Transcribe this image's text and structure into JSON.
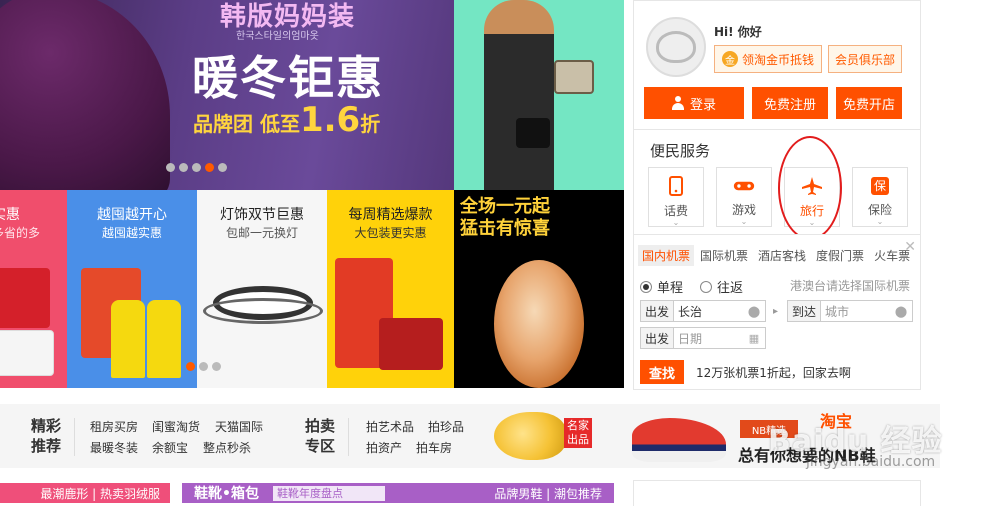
{
  "hero": {
    "title": "韩版妈妈装",
    "korean": "한국스타일의엄마옷",
    "headline": "暖冬钜惠",
    "promo_prefix": "品牌团 低至",
    "promo_number": "1.6",
    "promo_suffix": "折"
  },
  "login": {
    "greeting": "Hi! 你好",
    "coin_icon": "金",
    "coin_label": "领淘金币抵钱",
    "club_label": "会员俱乐部",
    "login_label": "登录",
    "register_label": "免费注册",
    "open_shop_label": "免费开店"
  },
  "service": {
    "title": "便民服务",
    "items": [
      {
        "label": "话费",
        "icon": "phone-icon"
      },
      {
        "label": "游戏",
        "icon": "gamepad-icon"
      },
      {
        "label": "旅行",
        "icon": "airplane-icon",
        "active": true
      },
      {
        "label": "保险",
        "icon": "insurance-icon",
        "glyph": "保"
      }
    ]
  },
  "flight": {
    "tabs": [
      "国内机票",
      "国际机票",
      "酒店客栈",
      "度假门票",
      "火车票"
    ],
    "one_way": "单程",
    "round_trip": "往返",
    "intl_hint": "港澳台请选择国际机票",
    "from_tag": "出发",
    "from_value": "长治",
    "to_tag": "到达",
    "to_placeholder": "城市",
    "date_tag": "出发",
    "date_placeholder": "日期",
    "search_label": "查找",
    "promo": "12万张机票1折起，回家去啊"
  },
  "tiles": [
    {
      "title": "实惠",
      "sub": "多省的多"
    },
    {
      "title": "越囤越开心",
      "sub": "越囤越实惠"
    },
    {
      "title": "灯饰双节巨惠",
      "sub": "包邮一元换灯"
    },
    {
      "title": "每周精选爆款",
      "sub": "大包装更实惠"
    },
    {
      "title": "全场一元起",
      "sub": "猛击有惊喜"
    }
  ],
  "category": {
    "head1": "精彩推荐",
    "links1": [
      "租房买房",
      "闺蜜淘货",
      "天猫国际",
      "最暖冬装",
      "余额宝",
      "整点秒杀"
    ],
    "head2": "拍卖专区",
    "links2": [
      "拍艺术品",
      "拍珍品",
      "拍资产",
      "拍车房"
    ],
    "famous_tag": "名家出品",
    "nb_tag": "NB精选",
    "nb_text": "总有你想要的NB鞋",
    "taobao_logo": "淘宝"
  },
  "watermark": {
    "text": "Baidu 经验",
    "sub": "jingyan.baidu.com"
  },
  "bottom": {
    "left": "最潮鹿形 | 热卖羽绒服",
    "mid_title": "鞋靴•箱包",
    "mid_chip": "鞋靴年度盘点",
    "mid_right": "品牌男鞋 | 潮包推荐"
  },
  "colors": {
    "accent": "#ff5000",
    "hero_bg": "#5b3d86",
    "annotation": "#e21c1c"
  }
}
